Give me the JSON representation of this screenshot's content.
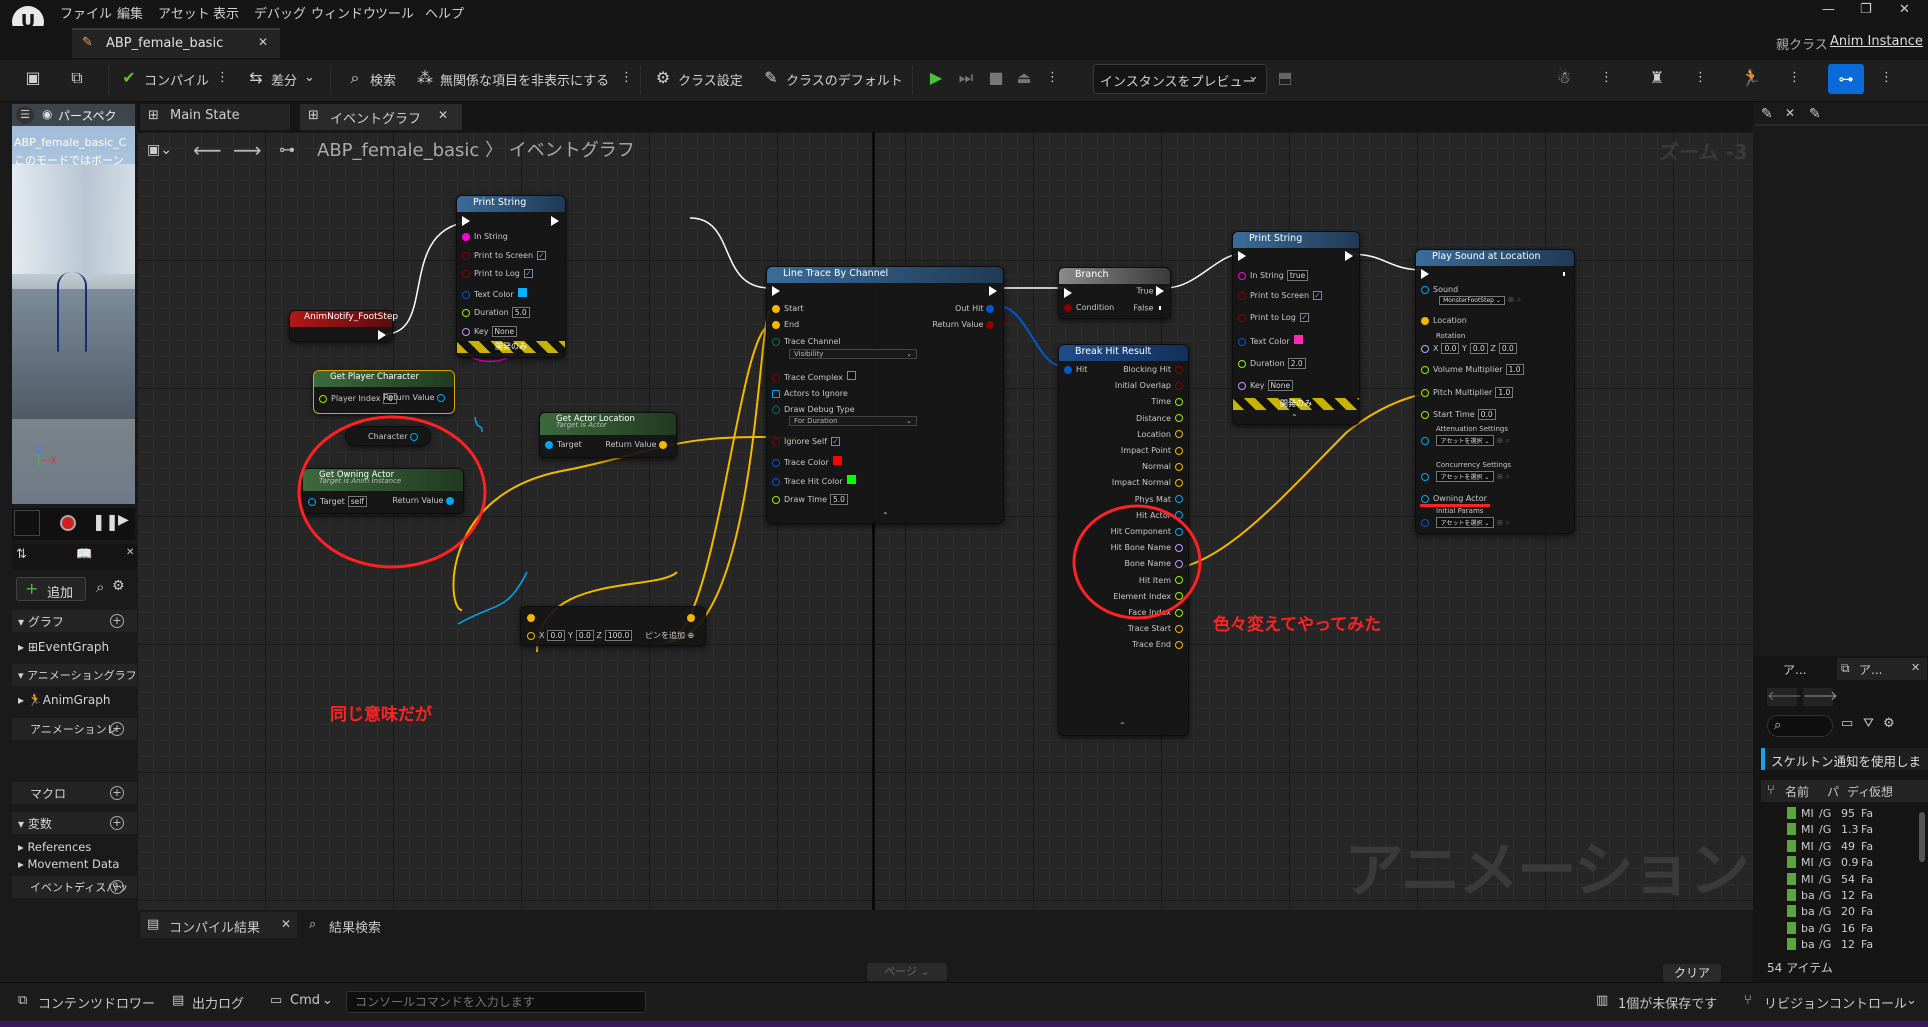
{
  "menu": [
    "ファイル",
    "編集",
    "アセット",
    "表示",
    "デバッグ",
    "ウィンドウ",
    "ツール",
    "ヘルプ"
  ],
  "tab": {
    "title": "ABP_female_basic"
  },
  "parent": {
    "label": "親クラス",
    "value": "Anim Instance"
  },
  "toolbar": {
    "compile": "コンパイル",
    "diff": "差分",
    "search": "検索",
    "hide": "無関係な項目を非表示にする",
    "class_settings": "クラス設定",
    "class_defaults": "クラスのデフォルト",
    "preview": "インスタンスをプレビュー"
  },
  "viewport": {
    "mode": "パースペク",
    "line1": "ABP_female_basic_C",
    "line2": "このモードではボーン"
  },
  "graph_tabs": [
    "Main State",
    "イベントグラフ"
  ],
  "breadcrumb": {
    "asset": "ABP_female_basic",
    "graph": "イベントグラフ"
  },
  "zoom": "ズーム -3",
  "watermark": "アニメーション",
  "left": {
    "add": "追加",
    "graph": "グラフ",
    "event_graph": "EventGraph",
    "anim_graph_section": "アニメーショングラフ",
    "anim_graph": "AnimGraph",
    "anim_layer": "アニメーションレ",
    "macro": "マクロ",
    "vars": "変数",
    "references": "References",
    "movement": "Movement Data",
    "dispatch": "イベントディスパッ"
  },
  "nodes": {
    "print1": {
      "title": "Print String",
      "in_string": "In String",
      "print_screen": "Print to Screen",
      "print_log": "Print to Log",
      "text_color": "Text Color",
      "duration": "Duration",
      "duration_val": "5.0",
      "key": "Key",
      "key_val": "None",
      "dev": "開発のみ"
    },
    "notify": {
      "title": "AnimNotify_FootStep"
    },
    "get_player": {
      "title": "Get Player Character",
      "player_index": "Player Index",
      "player_index_val": "0",
      "return": "Return Value"
    },
    "character": {
      "label": "Character"
    },
    "get_actor_loc": {
      "title": "Get Actor Location",
      "sub": "Target is Actor",
      "target": "Target",
      "return": "Return Value"
    },
    "get_owning": {
      "title": "Get Owning Actor",
      "sub": "Target is Anim Instance",
      "target": "Target",
      "target_val": "self",
      "return": "Return Value"
    },
    "add": {
      "x": "0.0",
      "y": "0.0",
      "z": "100.0",
      "label": "ピンを追加"
    },
    "trace": {
      "title": "Line Trace By Channel",
      "start": "Start",
      "end": "End",
      "out_hit": "Out Hit",
      "return": "Return Value",
      "channel": "Trace Channel",
      "channel_val": "Visibility",
      "complex": "Trace Complex",
      "ignore": "Actors to Ignore",
      "debug": "Draw Debug Type",
      "debug_val": "For Duration",
      "ignore_self": "Ignore Self",
      "trace_color": "Trace Color",
      "hit_color": "Trace Hit Color",
      "draw_time": "Draw Time",
      "draw_time_val": "5.0"
    },
    "branch": {
      "title": "Branch",
      "condition": "Condition",
      "true": "True",
      "false": "False"
    },
    "break": {
      "title": "Break Hit Result",
      "hit": "Hit",
      "pins": [
        "Blocking Hit",
        "Initial Overlap",
        "Time",
        "Distance",
        "Location",
        "Impact Point",
        "Normal",
        "Impact Normal",
        "Phys Mat",
        "Hit Actor",
        "Hit Component",
        "Hit Bone Name",
        "Bone Name",
        "Hit Item",
        "Element Index",
        "Face Index",
        "Trace Start",
        "Trace End"
      ]
    },
    "print2": {
      "title": "Print String",
      "in_string": "In String",
      "in_val": "true",
      "print_screen": "Print to Screen",
      "print_log": "Print to Log",
      "text_color": "Text Color",
      "duration": "Duration",
      "duration_val": "2.0",
      "key": "Key",
      "key_val": "None",
      "dev": "開発のみ"
    },
    "play": {
      "title": "Play Sound at Location",
      "sound": "Sound",
      "sound_val": "MonsterFootStep",
      "location": "Location",
      "rotation": "Rotation",
      "rx": "0.0",
      "ry": "0.0",
      "rz": "0.0",
      "volume": "Volume Multiplier",
      "volume_val": "1.0",
      "pitch": "Pitch Multiplier",
      "pitch_val": "1.0",
      "start": "Start Time",
      "start_val": "0.0",
      "atten": "Attenuation Settings",
      "concur": "Concurrency Settings",
      "select": "アセットを選択",
      "owning": "Owning Actor",
      "initial": "Initial Params"
    }
  },
  "annotations": {
    "same": "同じ意味だが",
    "tried": "色々変えてやってみた"
  },
  "bottom": {
    "compile_results": "コンパイル結果",
    "search_results": "結果検索",
    "page": "ページ",
    "clear": "クリア"
  },
  "right": {
    "tab1": "ア...",
    "tab2": "ア...",
    "skeleton": "スケルトン通知を使用しま",
    "cols": [
      "名前",
      "パ",
      "ディ",
      "仮想"
    ],
    "rows": [
      [
        "MI",
        "/G",
        "95",
        "Fa"
      ],
      [
        "MI",
        "/G",
        "1.3",
        "Fa"
      ],
      [
        "MI",
        "/G",
        "49",
        "Fa"
      ],
      [
        "MI",
        "/G",
        "0.9",
        "Fa"
      ],
      [
        "MI",
        "/G",
        "54",
        "Fa"
      ],
      [
        "ba",
        "/G",
        "12",
        "Fa"
      ],
      [
        "ba",
        "/G",
        "20",
        "Fa"
      ],
      [
        "ba",
        "/G",
        "16",
        "Fa"
      ],
      [
        "ba",
        "/G",
        "12",
        "Fa"
      ]
    ],
    "count": "54 アイテム"
  },
  "status": {
    "content": "コンテンツドロワー",
    "output": "出力ログ",
    "cmd": "Cmd",
    "console_placeholder": "コンソールコマンドを入力します",
    "unsaved": "1個が未保存です",
    "revision": "リビジョンコントロール"
  },
  "colors": {
    "exec": "#ffffff",
    "vector": "#f5b800",
    "object": "#00a8f3",
    "bool": "#8c0000",
    "string": "#ff00d4",
    "struct": "#0059cb",
    "name": "#c594ff",
    "float": "#98ef00",
    "annotation": "#ff2222"
  }
}
